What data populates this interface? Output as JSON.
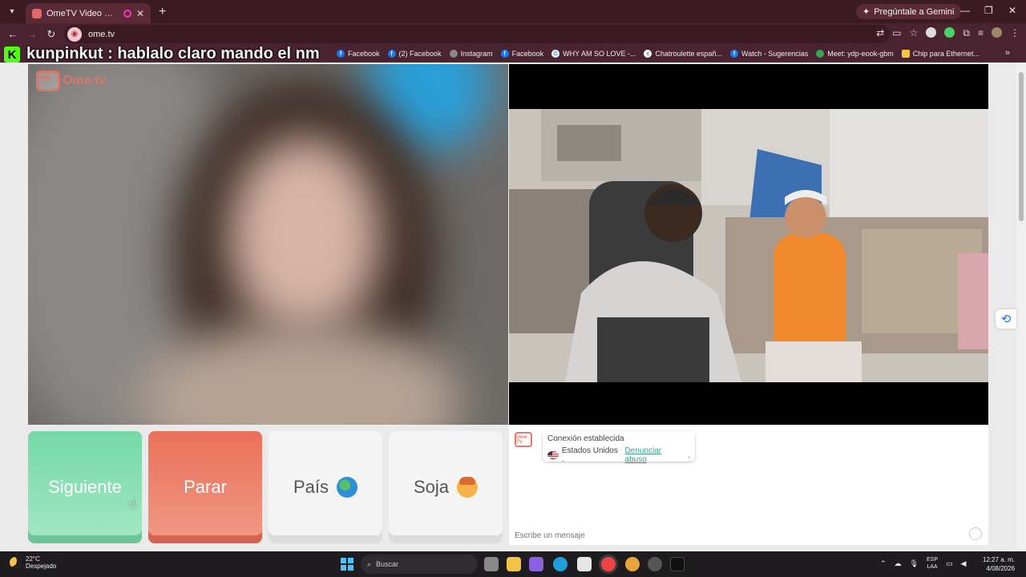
{
  "browser": {
    "tab_title": "OmeTV Video Chat — Alternative",
    "gemini_label": "Pregúntale a Gemini",
    "url": "ome.tv"
  },
  "bookmarks": [
    {
      "label": "Facebook",
      "icon": "facebook-icon"
    },
    {
      "label": "(2) Facebook",
      "icon": "facebook-icon"
    },
    {
      "label": "Instagram",
      "icon": "globe-icon"
    },
    {
      "label": "Facebook",
      "icon": "facebook-icon"
    },
    {
      "label": "WHY AM SO LOVE -...",
      "icon": "google-icon"
    },
    {
      "label": "Chatroulette españ...",
      "icon": "chatroulette-icon"
    },
    {
      "label": "Watch - Sugerencias",
      "icon": "facebook-icon"
    },
    {
      "label": "Meet: ydp-eook-gbm",
      "icon": "meet-icon"
    },
    {
      "label": "Chip para Ethernet...",
      "icon": "folder-icon"
    }
  ],
  "overlay": {
    "kick_logo": "K",
    "chat_message": "kunpinkut : hablalo claro mando el nm"
  },
  "ome_logo": {
    "badge": "Ome TV",
    "text": "Ome.tv"
  },
  "buttons": {
    "next": "Siguiente",
    "stop": "Parar",
    "country": "País",
    "gender": "Soja"
  },
  "chat": {
    "logo_badge": "Ome TV",
    "status": "Conexión establecida",
    "country": "Estados Unidos .",
    "report": "Denunciar abuso",
    "report_suffix": ".",
    "placeholder": "Escribe un mensaje"
  },
  "taskbar": {
    "temperature": "22°C",
    "weather": "Despejado",
    "search": "Buscar",
    "lang_top": "ESP",
    "lang_bottom": "LAA",
    "time": "12:27 a. m.",
    "date": "4/08/2026"
  },
  "colors": {
    "next_button": "#74d9a5",
    "stop_button": "#ea7058",
    "browser_frame": "#3b1a23",
    "kick_green": "#53fc18"
  }
}
